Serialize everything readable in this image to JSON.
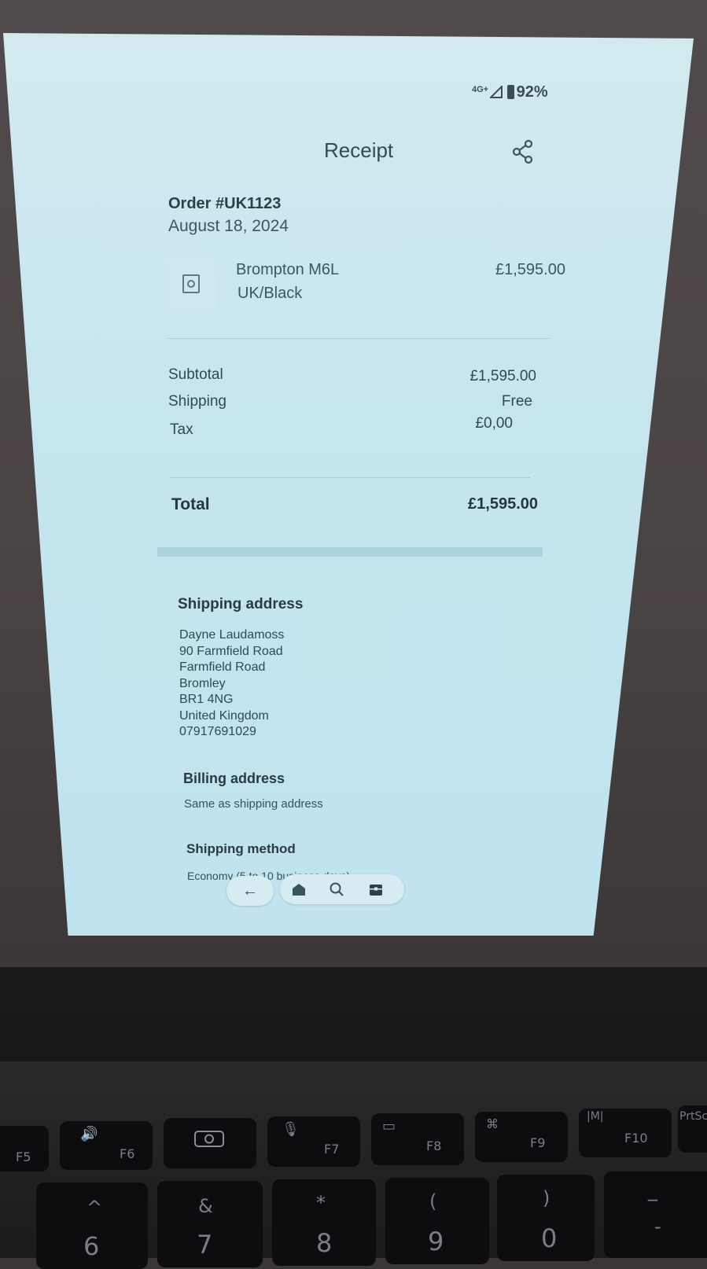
{
  "status_bar": {
    "network": "4G+",
    "battery": "92%"
  },
  "header": {
    "title": "Receipt",
    "share_icon": "share-icon"
  },
  "order": {
    "number": "Order #UK1123",
    "date": "August 18, 2024"
  },
  "item": {
    "name": "Brompton M6L",
    "variant": "UK/Black",
    "price": "£1,595.00",
    "thumbnail_icon": "image-placeholder-icon"
  },
  "summary": {
    "subtotal_label": "Subtotal",
    "subtotal_value": "£1,595.00",
    "shipping_label": "Shipping",
    "shipping_value": "Free",
    "tax_label": "Tax",
    "tax_value": "£0,00",
    "total_label": "Total",
    "total_value": "£1,595.00"
  },
  "shipping_address": {
    "heading": "Shipping address",
    "lines": [
      "Dayne Laudamoss",
      "90 Farmfield Road",
      "Farmfield Road",
      "Bromley",
      "BR1 4NG",
      "United Kingdom",
      "07917691029"
    ]
  },
  "billing_address": {
    "heading": "Billing address",
    "value": "Same as shipping address"
  },
  "shipping_method": {
    "heading": "Shipping method",
    "value": "Economy (5 to 10 business days)"
  },
  "nav_bar": {
    "back_icon": "back-arrow-icon",
    "home_icon": "home-icon",
    "search_icon": "search-icon",
    "store_icon": "store-icon"
  },
  "keyboard": {
    "function_row": [
      "F5",
      "F6",
      "F7",
      "F8",
      "F9",
      "F10",
      "PrtSc"
    ],
    "number_row": [
      {
        "upper": "^",
        "lower": "6"
      },
      {
        "upper": "&",
        "lower": "7"
      },
      {
        "upper": "*",
        "lower": "8"
      },
      {
        "upper": "(",
        "lower": "9"
      },
      {
        "upper": ")",
        "lower": "0"
      },
      {
        "upper": "_",
        "lower": "-"
      }
    ]
  }
}
